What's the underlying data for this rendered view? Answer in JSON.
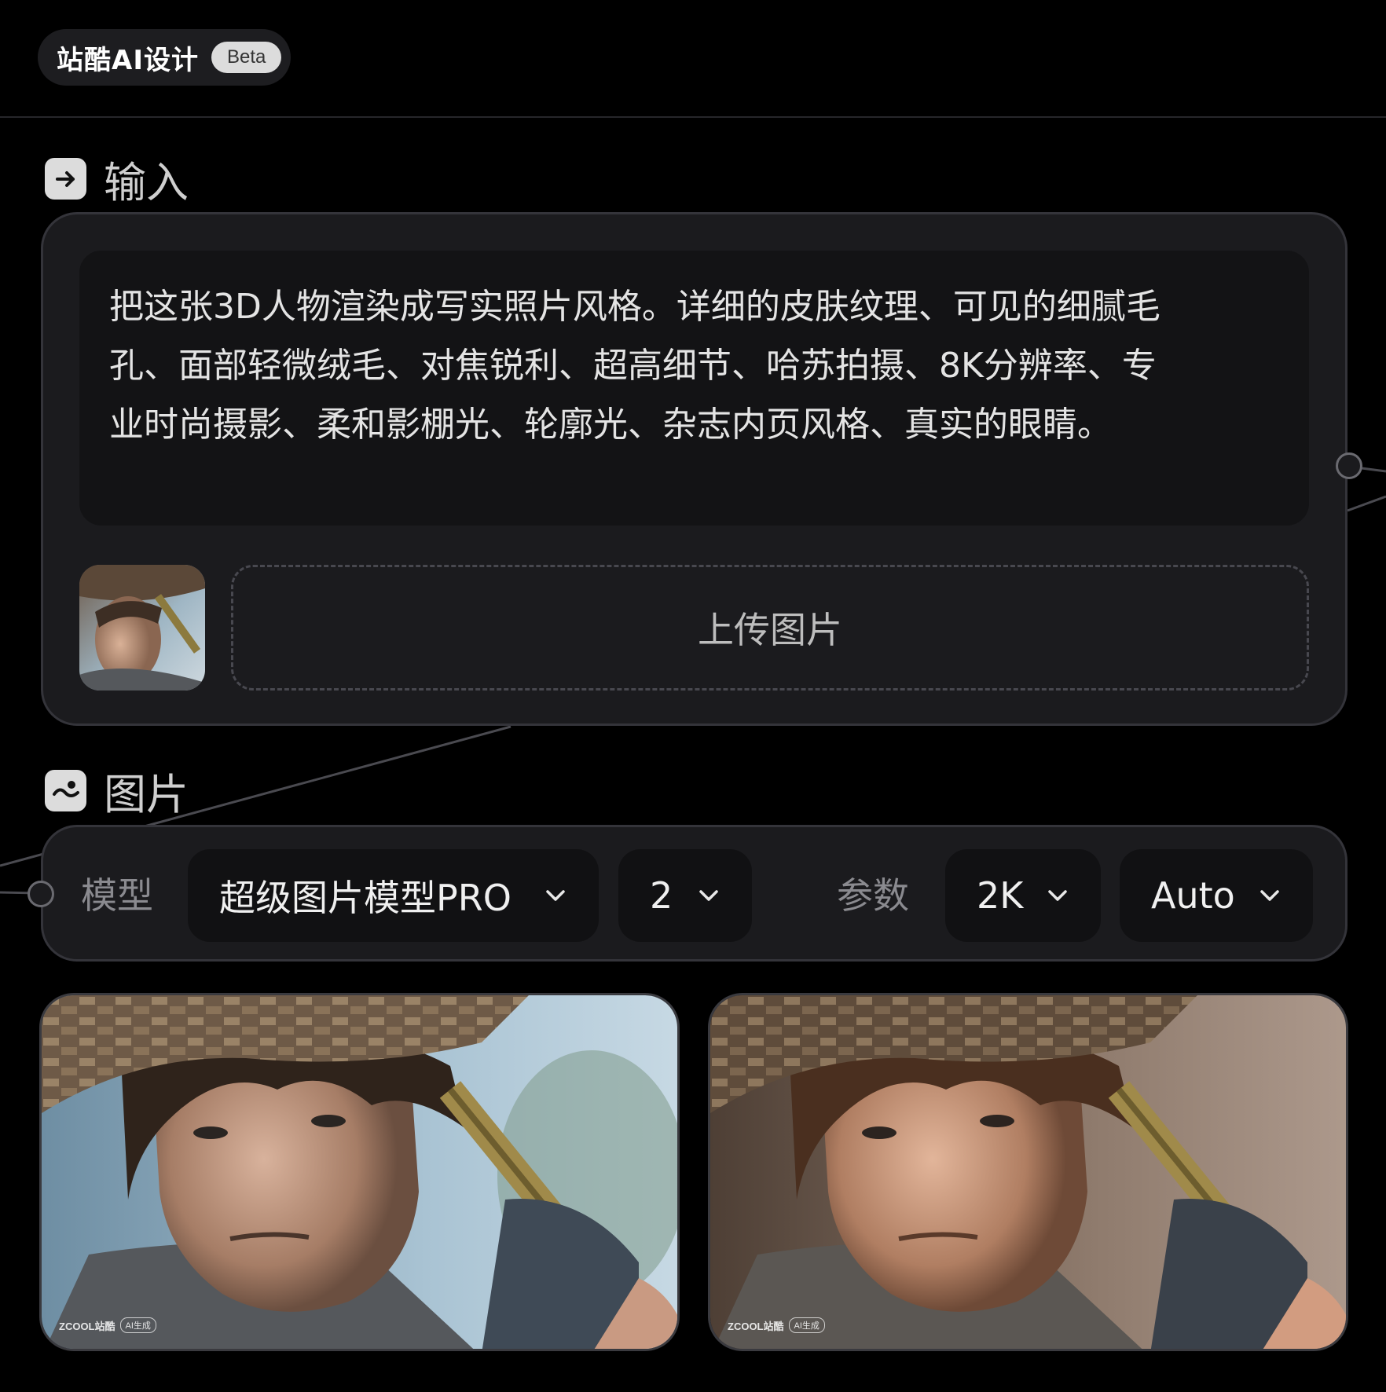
{
  "header": {
    "brand": "站酷AI设计",
    "badge": "Beta"
  },
  "input_section": {
    "icon": "arrow-right-icon",
    "title": "输入",
    "prompt_lines": [
      "把这张3D人物渲染成写实照片风格。详细的皮肤纹理、可见的细腻毛",
      "孔、面部轻微绒毛、对焦锐利、超高细节、哈苏拍摄、8K分辨率、专",
      "业时尚摄影、柔和影棚光、轮廓光、杂志内页风格、真实的眼睛。"
    ],
    "upload_label": "上传图片"
  },
  "image_section": {
    "icon": "image-icon",
    "title": "图片",
    "model_label": "模型",
    "model_value": "超级图片模型PRO",
    "count_value": "2",
    "params_label": "参数",
    "resolution_value": "2K",
    "ratio_value": "Auto"
  },
  "results": [
    {
      "name": "source-render",
      "watermark_brand": "ZCOOL站酷",
      "watermark_tag": "AI生成"
    },
    {
      "name": "photoreal-render",
      "watermark_brand": "ZCOOL站酷",
      "watermark_tag": "AI生成"
    }
  ],
  "colors": {
    "background": "#000000",
    "card": "#1b1b1e",
    "field": "#111113",
    "border": "#34343a",
    "text": "#e4e4e4",
    "muted": "#8a8a8f"
  }
}
